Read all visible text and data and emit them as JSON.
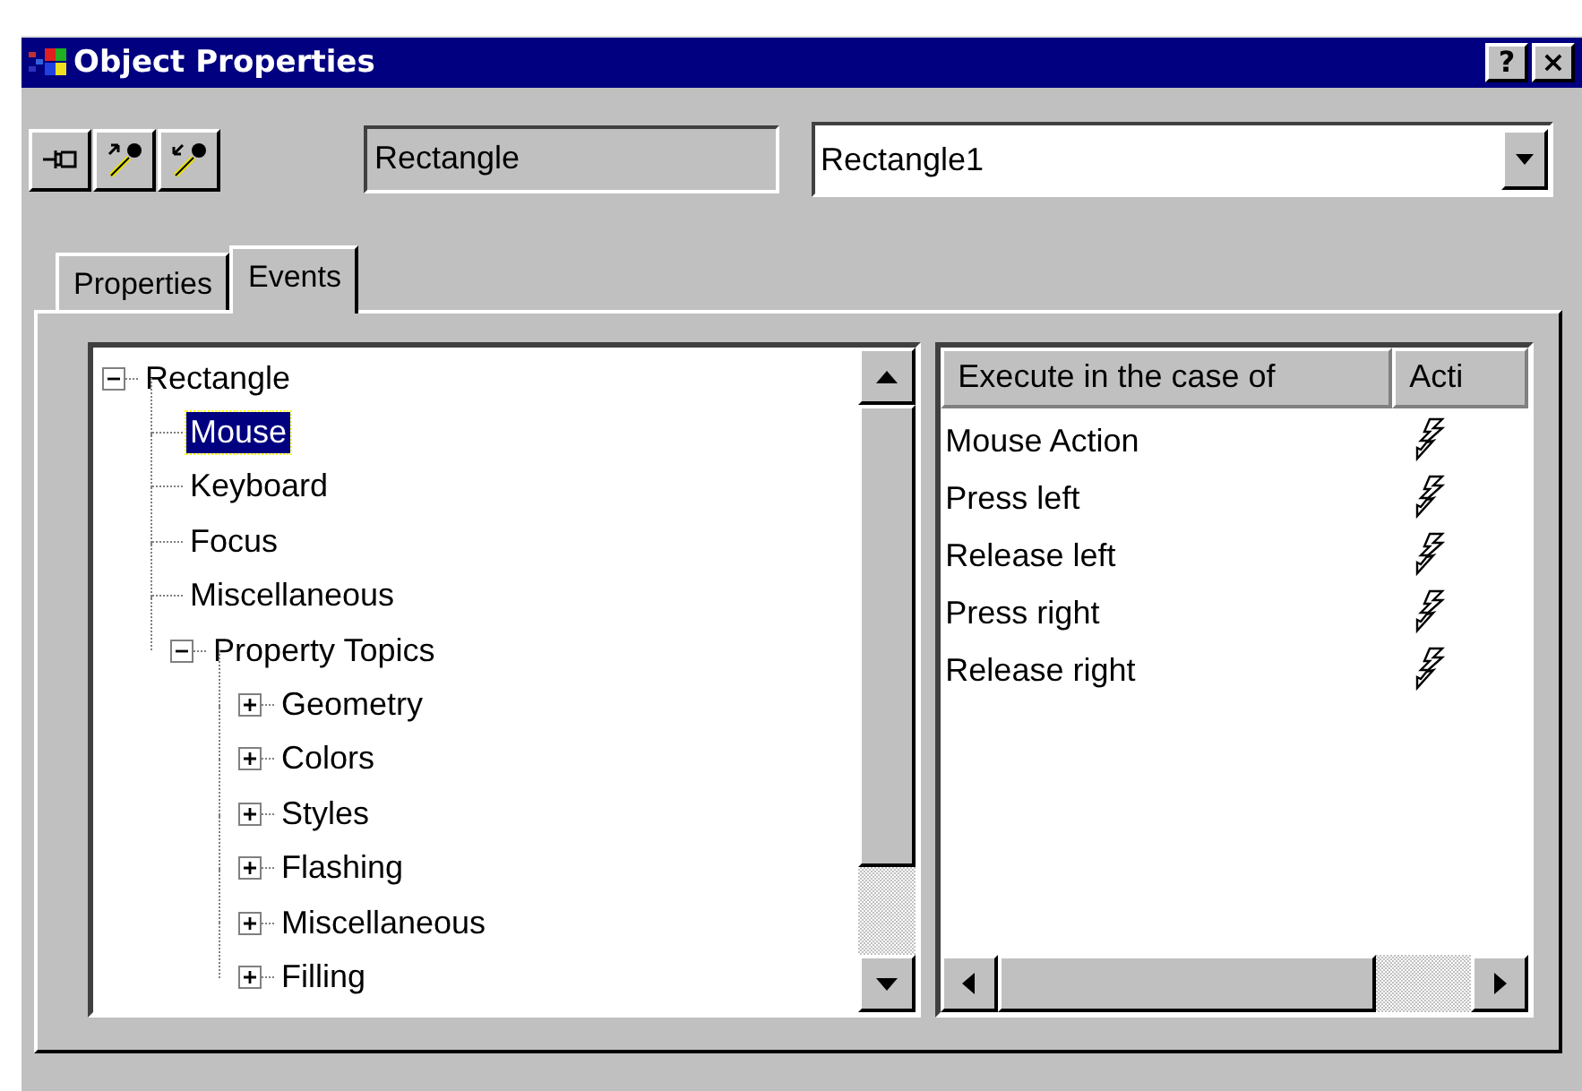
{
  "window": {
    "title": "Object Properties"
  },
  "title_buttons": [
    "?",
    "×"
  ],
  "object_type": "Rectangle",
  "object_name": {
    "value": "Rectangle1"
  },
  "tabs": [
    {
      "label": "Properties",
      "selected": false
    },
    {
      "label": "Events",
      "selected": true
    }
  ],
  "tree": [
    {
      "label": "Rectangle",
      "selected": false,
      "expanded": true,
      "children": [
        {
          "label": "Mouse",
          "selected": true
        },
        {
          "label": "Keyboard",
          "selected": false
        },
        {
          "label": "Focus",
          "selected": false
        },
        {
          "label": "Miscellaneous",
          "selected": false
        },
        {
          "label": "Property Topics",
          "selected": false,
          "expanded": true,
          "children": [
            {
              "label": "Geometry",
              "selected": false,
              "expanded": false
            },
            {
              "label": "Colors",
              "selected": false,
              "expanded": false
            },
            {
              "label": "Styles",
              "selected": false,
              "expanded": false
            },
            {
              "label": "Flashing",
              "selected": false,
              "expanded": false
            },
            {
              "label": "Miscellaneous",
              "selected": false,
              "expanded": false
            },
            {
              "label": "Filling",
              "selected": false,
              "expanded": false
            }
          ]
        }
      ]
    }
  ],
  "event_list": {
    "columns": [
      "Execute in the case of",
      "Acti"
    ],
    "rows": [
      {
        "event": "Mouse Action"
      },
      {
        "event": "Press left"
      },
      {
        "event": "Release left"
      },
      {
        "event": "Press right"
      },
      {
        "event": "Release right"
      }
    ]
  }
}
